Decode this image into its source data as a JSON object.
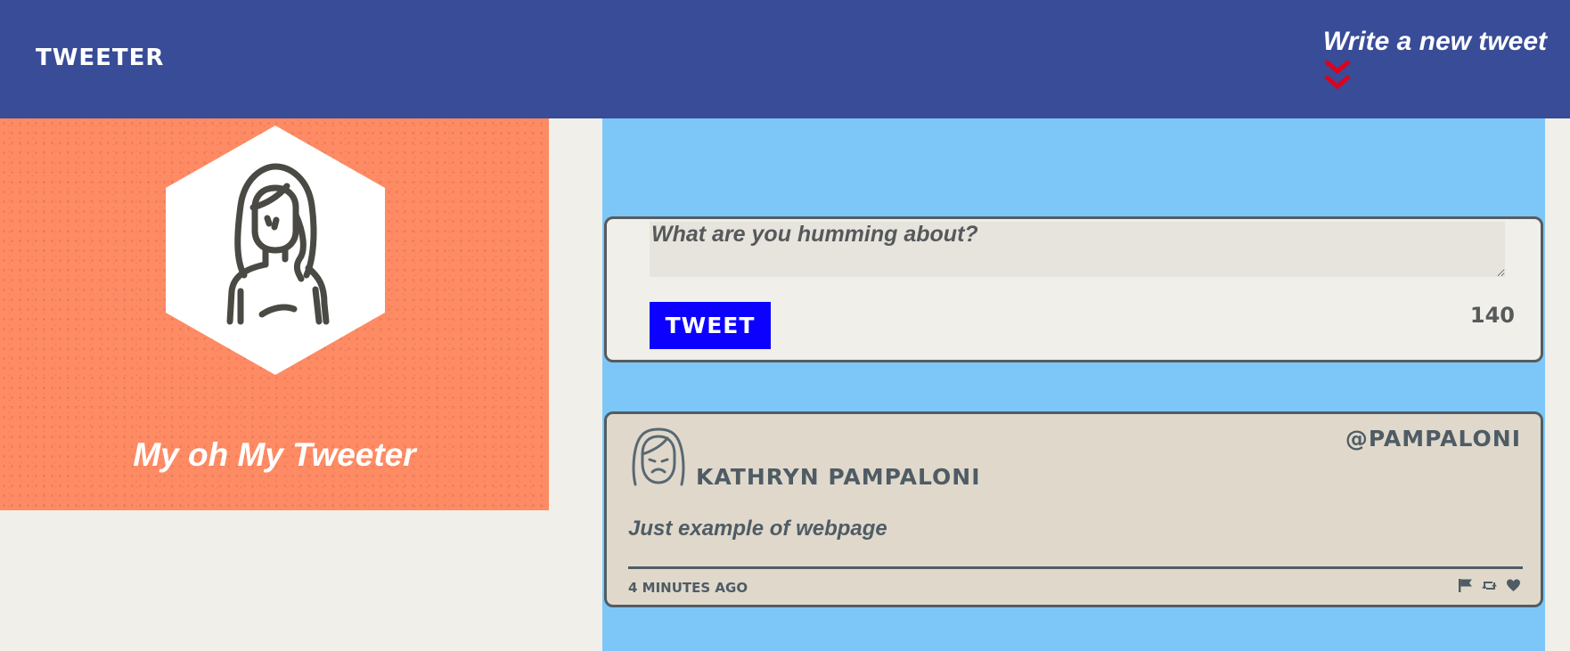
{
  "nav": {
    "brand": "TWEETER",
    "compose_label": "Write a new tweet",
    "compose_icon": "double-chevron-down-icon",
    "compose_icon_color": "#e0001b"
  },
  "profile": {
    "display_name": "My oh My Tweeter",
    "avatar_icon": "woman-avatar-icon"
  },
  "compose": {
    "placeholder": "What are you humming about?",
    "value": "",
    "button_label": "TWEET",
    "counter": "140"
  },
  "tweets": [
    {
      "avatar_icon": "sad-woman-avatar-icon",
      "author": "KATHRYN PAMPALONI",
      "handle": "@PAMPALONI",
      "content": "Just example of webpage",
      "time": "4 MINUTES AGO",
      "actions": [
        "flag-icon",
        "retweet-icon",
        "heart-icon"
      ]
    }
  ],
  "colors": {
    "nav_bg": "#384c97",
    "profile_bg": "#ff8b64",
    "main_bg": "#7cc7f8",
    "page_bg": "#f1efe9",
    "tweet_button": "#0c00ff",
    "text_dark": "#4f5c65"
  }
}
